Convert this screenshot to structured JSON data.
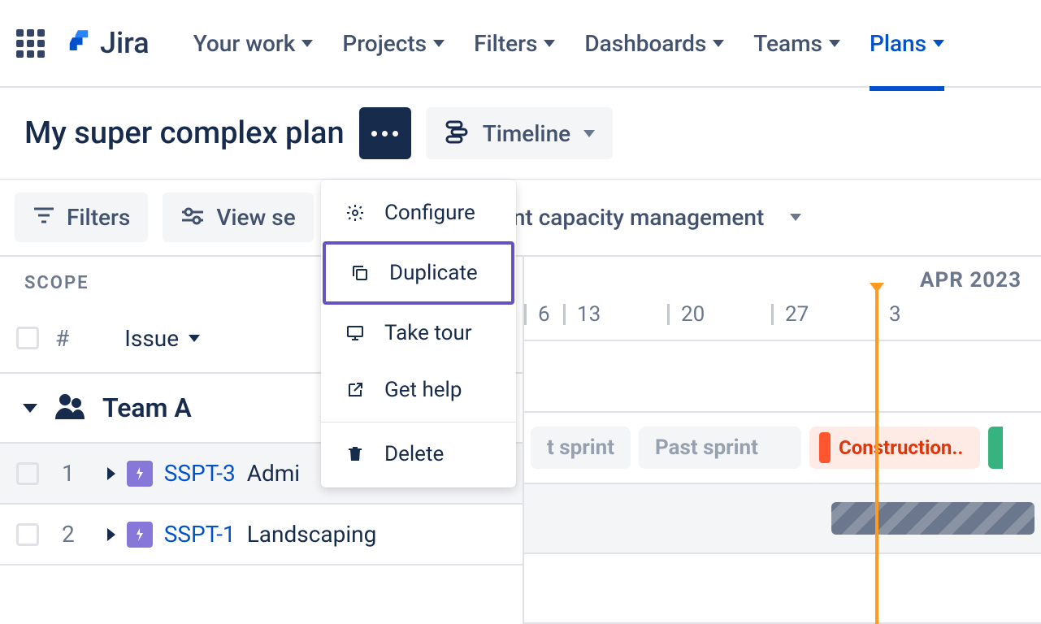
{
  "brand": "Jira",
  "nav": {
    "your_work": "Your work",
    "projects": "Projects",
    "filters": "Filters",
    "dashboards": "Dashboards",
    "teams": "Teams",
    "plans": "Plans"
  },
  "plan": {
    "title": "My super complex plan",
    "view_label": "Timeline"
  },
  "toolbar": {
    "filters_label": "Filters",
    "view_settings_prefix": "View se",
    "sprint_capacity_label": "int capacity management"
  },
  "menu": {
    "configure": "Configure",
    "duplicate": "Duplicate",
    "take_tour": "Take tour",
    "get_help": "Get help",
    "delete": "Delete"
  },
  "columns": {
    "scope": "SCOPE",
    "hash": "#",
    "issue": "Issue"
  },
  "timeline": {
    "month": "APR 2023",
    "dates": [
      "6",
      "13",
      "20",
      "27",
      "3"
    ]
  },
  "team_row": {
    "name": "Team A"
  },
  "sprints": {
    "past1": "t sprint",
    "past2": "Past sprint",
    "construction": "Construction.."
  },
  "issues": [
    {
      "num": "1",
      "key": "SSPT-3",
      "title": "Admi"
    },
    {
      "num": "2",
      "key": "SSPT-1",
      "title": "Landscaping"
    }
  ]
}
